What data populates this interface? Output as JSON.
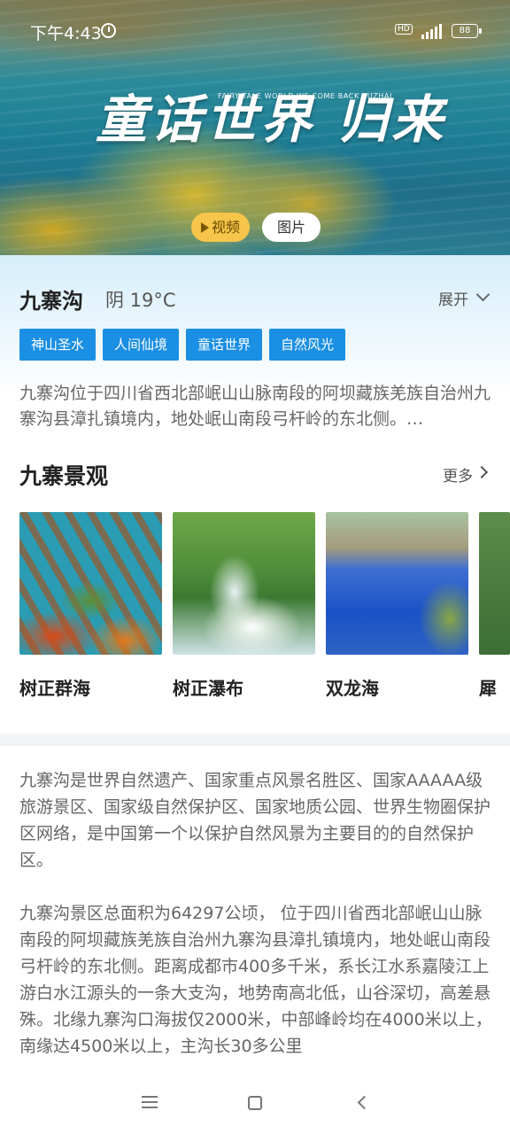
{
  "status_bar": {
    "time": "下午4:43",
    "hd_label": "HD",
    "battery": "88"
  },
  "hero": {
    "title": "童话世界 归来",
    "subtitle": "FAIRY TALE WORLD WE COME BACK JIUZHAI",
    "video_label": "视频",
    "photo_label": "图片"
  },
  "info": {
    "name": "九寨沟",
    "weather": "阴 19°C",
    "expand_label": "展开",
    "tags": [
      "神山圣水",
      "人间仙境",
      "童话世界",
      "自然风光"
    ],
    "description": "九寨沟位于四川省西北部岷山山脉南段的阿坝藏族羌族自治州九寨沟县漳扎镇境内，地处岷山南段弓杆岭的东北侧。…"
  },
  "scenic": {
    "title": "九寨景观",
    "more_label": "更多",
    "items": [
      {
        "label": "树正群海"
      },
      {
        "label": "树正瀑布"
      },
      {
        "label": "双龙海"
      },
      {
        "label": "犀"
      }
    ]
  },
  "article": {
    "paragraphs": [
      "九寨沟是世界自然遗产、国家重点风景名胜区、国家AAAAA级旅游景区、国家级自然保护区、国家地质公园、世界生物圈保护区网络，是中国第一个以保护自然风景为主要目的的自然保护区。",
      "九寨沟景区总面积为64297公顷， 位于四川省西北部岷山山脉南段的阿坝藏族羌族自治州九寨沟县漳扎镇境内，地处岷山南段弓杆岭的东北侧。距离成都市400多千米，系长江水系嘉陵江上游白水江源头的一条大支沟，地势南高北低，山谷深切，高差悬殊。北缘九寨沟口海拔仅2000米，中部峰岭均在4000米以上，南缘达4500米以上，主沟长30多公里"
    ]
  },
  "colors": {
    "accent": "#1a8fe3",
    "video_button": "#f6c54a",
    "divider": "#f3f4f6"
  },
  "icons": {
    "alarm": "alarm-icon",
    "signal": "signal-icon",
    "battery": "battery-icon",
    "play": "play-icon",
    "expand": "chevron-down-icon",
    "more": "chevron-right-icon",
    "menu": "menu-icon",
    "home": "home-icon",
    "back": "back-icon"
  }
}
